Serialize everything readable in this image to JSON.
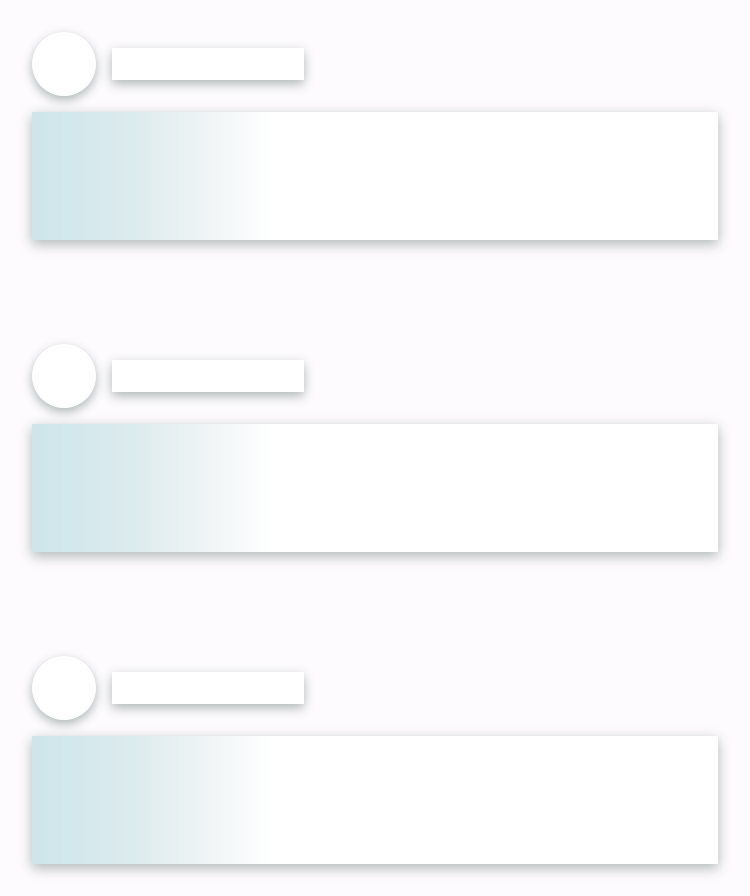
{
  "feed": {
    "state": "loading-skeleton",
    "placeholder_count": 3,
    "colors": {
      "background": "#fdfbfd",
      "placeholder": "#ffffff",
      "shimmer": "#cde6ea",
      "shadow": "#64787a"
    },
    "cards": [
      {
        "avatar_icon": "avatar-placeholder",
        "title": "",
        "body": ""
      },
      {
        "avatar_icon": "avatar-placeholder",
        "title": "",
        "body": ""
      },
      {
        "avatar_icon": "avatar-placeholder",
        "title": "",
        "body": ""
      }
    ]
  }
}
